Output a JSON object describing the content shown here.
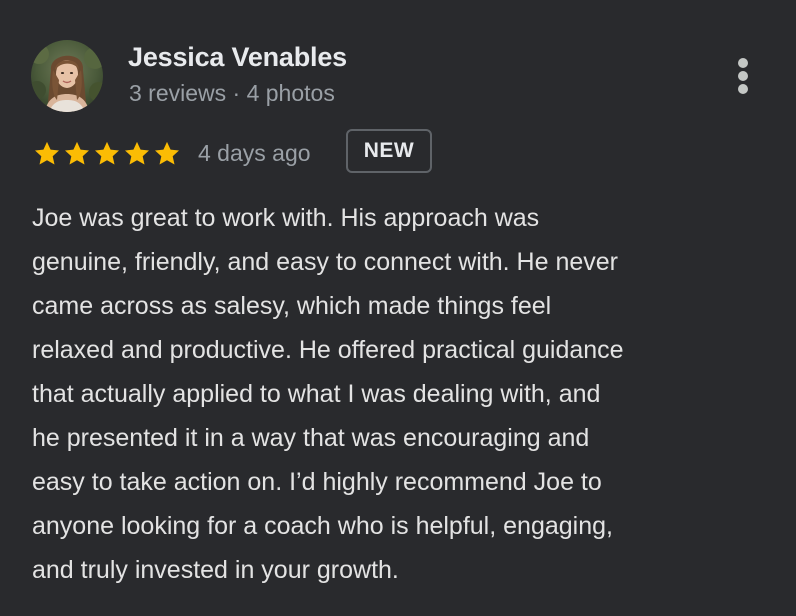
{
  "reviewer": {
    "name": "Jessica Venables",
    "meta": "3 reviews · 4 photos",
    "avatar_icon": "profile-photo"
  },
  "rating": {
    "stars": 5,
    "max": 5,
    "star_color": "#fbbc04"
  },
  "review": {
    "time_ago": "4 days ago",
    "badge": "NEW",
    "text_lines": [
      "Joe was great to work with. His approach was",
      "genuine, friendly, and easy to connect with. He never",
      "came across as salesy, which made things feel",
      "relaxed and productive. He offered practical guidance",
      "that actually applied to what I was dealing with, and",
      "he presented it in a way that was encouraging and",
      "easy to take action on. I’d highly recommend Joe to",
      "anyone looking for a coach who is helpful, engaging,",
      "and truly invested in your growth."
    ]
  },
  "menu": {
    "icon": "more-vert-icon"
  },
  "colors": {
    "background": "#292a2d",
    "primary_text": "#e8eaed",
    "secondary_text": "#9aa0a6",
    "badge_border": "#5f6368"
  }
}
